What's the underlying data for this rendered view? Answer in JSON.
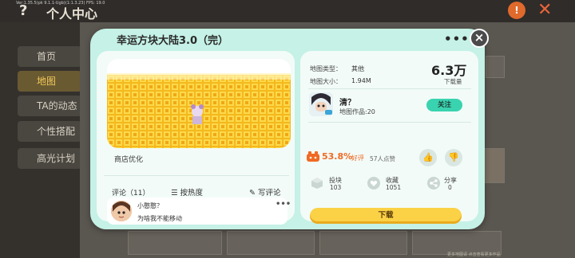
{
  "background": {
    "debug_line": "Ver:1.35.5(pk 9.1.1-Ugb)(1:1.3.23) FPS: 19.0",
    "help_glyph": "?",
    "page_title": "个人中心",
    "nav_items": [
      "首页",
      "地图",
      "TA的动态",
      "个性搭配",
      "高光计划"
    ],
    "footer_text": "更多地图请 点击查看更多作品"
  },
  "dialog": {
    "title": "幸运方块大陆3.0（完）",
    "more_glyph": "•••",
    "close_glyph": "×",
    "tag": "商店优化",
    "comments": {
      "label": "评论（11）",
      "sort_label": "按热度",
      "write_label": "写评论",
      "items": [
        {
          "user": "小憨憨？",
          "text": "为啥我不能移动",
          "more": "•••"
        }
      ]
    },
    "info": {
      "type_key": "地图类型：",
      "type_value": "其他",
      "size_key": "地图大小：",
      "size_value": "1.94M",
      "downloads_value": "6.3万",
      "downloads_label": "下载量"
    },
    "author": {
      "name": "清？",
      "works": "地图作品:20",
      "follow_label": "关注"
    },
    "rating": {
      "percent": "53.8%",
      "good_label": "好评",
      "count": "57人点赞"
    },
    "stats": [
      {
        "key": "投块",
        "value": "103",
        "icon": "cube-icon"
      },
      {
        "key": "收藏",
        "value": "1051",
        "icon": "heart-icon"
      },
      {
        "key": "分享",
        "value": "0",
        "icon": "share-icon"
      }
    ],
    "download_label": "下载"
  },
  "colors": {
    "dialog_bg": "#c5f1e6",
    "card_bg": "#f2fbf8",
    "accent_orange": "#f06a24",
    "follow_green": "#3ad3b0",
    "download_yellow": "#fbd146"
  }
}
